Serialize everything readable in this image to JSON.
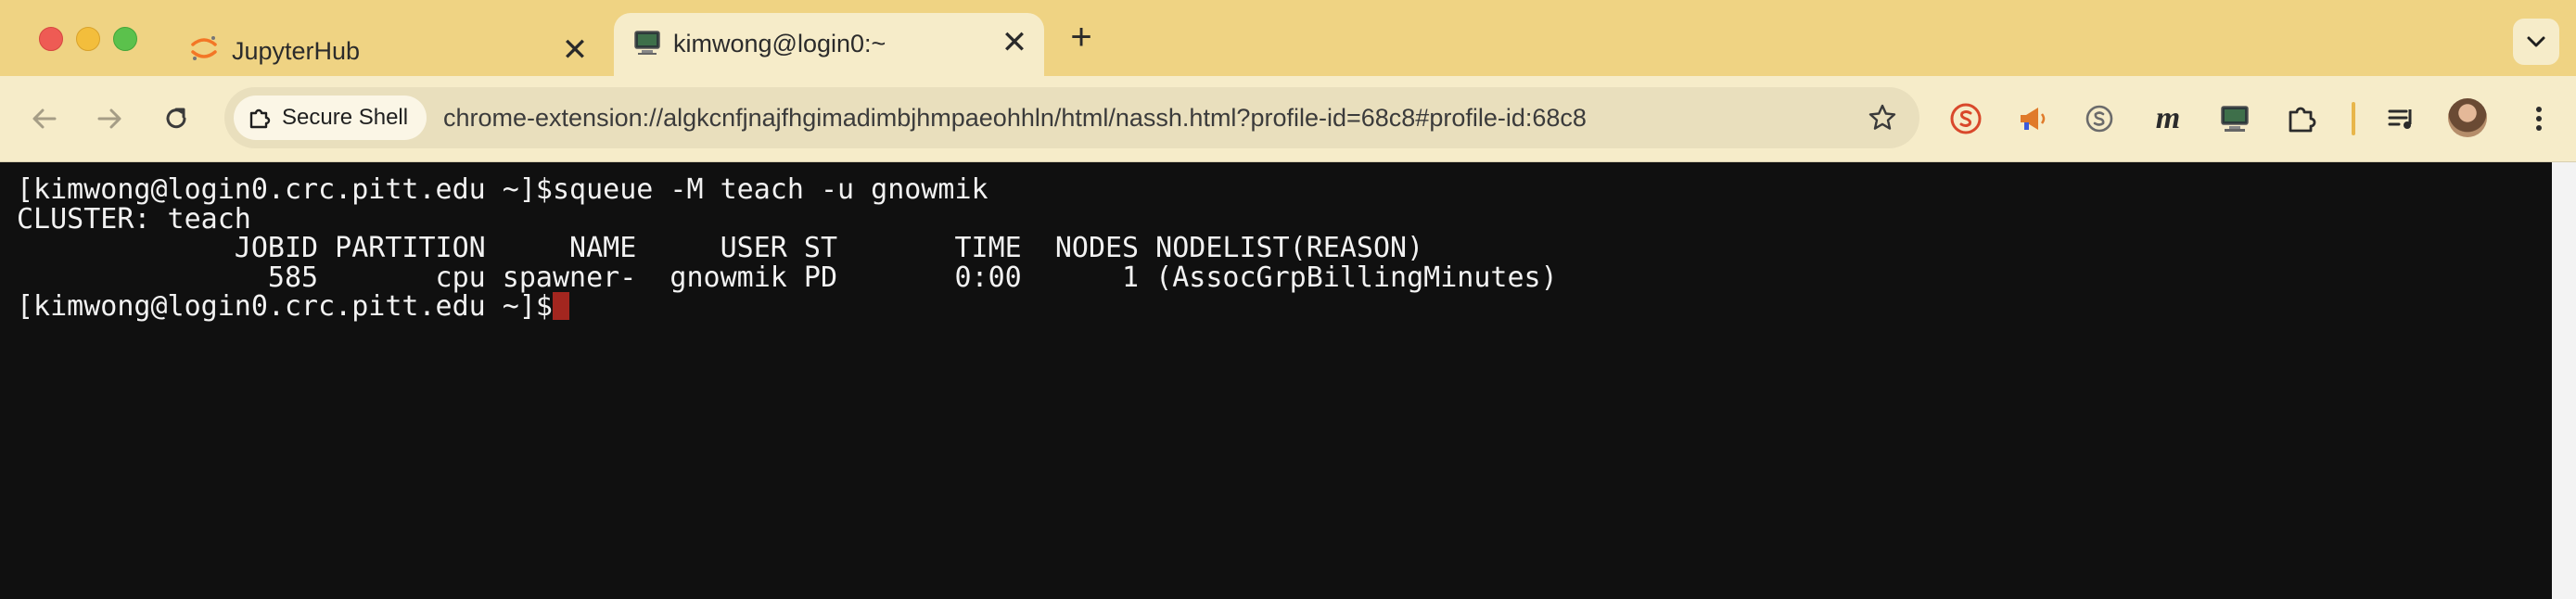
{
  "tabs": [
    {
      "title": "JupyterHub",
      "favicon": "jupyter-icon",
      "active": false
    },
    {
      "title": "kimwong@login0:~",
      "favicon": "terminal-icon",
      "active": true
    }
  ],
  "toolbar": {
    "security_chip": "Secure Shell",
    "url": "chrome-extension://algkcnfjnajfhgimadimbjhmpaeohhln/html/nassh.html?profile-id=68c8#profile-id:68c8"
  },
  "extensions": [
    "shield-s-icon",
    "megaphone-icon",
    "skype-icon",
    "m-icon",
    "terminal-icon",
    "puzzle-icon",
    "playlist-icon"
  ],
  "colors": {
    "tabstrip": "#efd383",
    "toolbar": "#f6ecc9",
    "terminal_bg": "#101010",
    "terminal_fg": "#f2f2f2",
    "cursor": "#a3261f"
  },
  "terminal": {
    "lines": [
      "[kimwong@login0.crc.pitt.edu ~]$squeue -M teach -u gnowmik",
      "CLUSTER: teach",
      "             JOBID PARTITION     NAME     USER ST       TIME  NODES NODELIST(REASON)",
      "               585       cpu spawner-  gnowmik PD       0:00      1 (AssocGrpBillingMinutes)"
    ],
    "prompt": "[kimwong@login0.crc.pitt.edu ~]$"
  }
}
